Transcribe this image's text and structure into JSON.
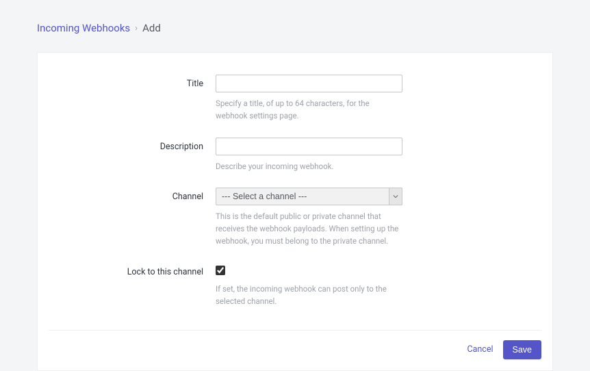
{
  "breadcrumb": {
    "parent": "Incoming Webhooks",
    "current": "Add"
  },
  "form": {
    "title": {
      "label": "Title",
      "value": "",
      "help": "Specify a title, of up to 64 characters, for the webhook settings page."
    },
    "description": {
      "label": "Description",
      "value": "",
      "help": "Describe your incoming webhook."
    },
    "channel": {
      "label": "Channel",
      "placeholder": "--- Select a channel ---",
      "help": "This is the default public or private channel that receives the webhook payloads. When setting up the webhook, you must belong to the private channel."
    },
    "lock": {
      "label": "Lock to this channel",
      "checked": true,
      "help": "If set, the incoming webhook can post only to the selected channel."
    }
  },
  "actions": {
    "cancel": "Cancel",
    "save": "Save"
  }
}
